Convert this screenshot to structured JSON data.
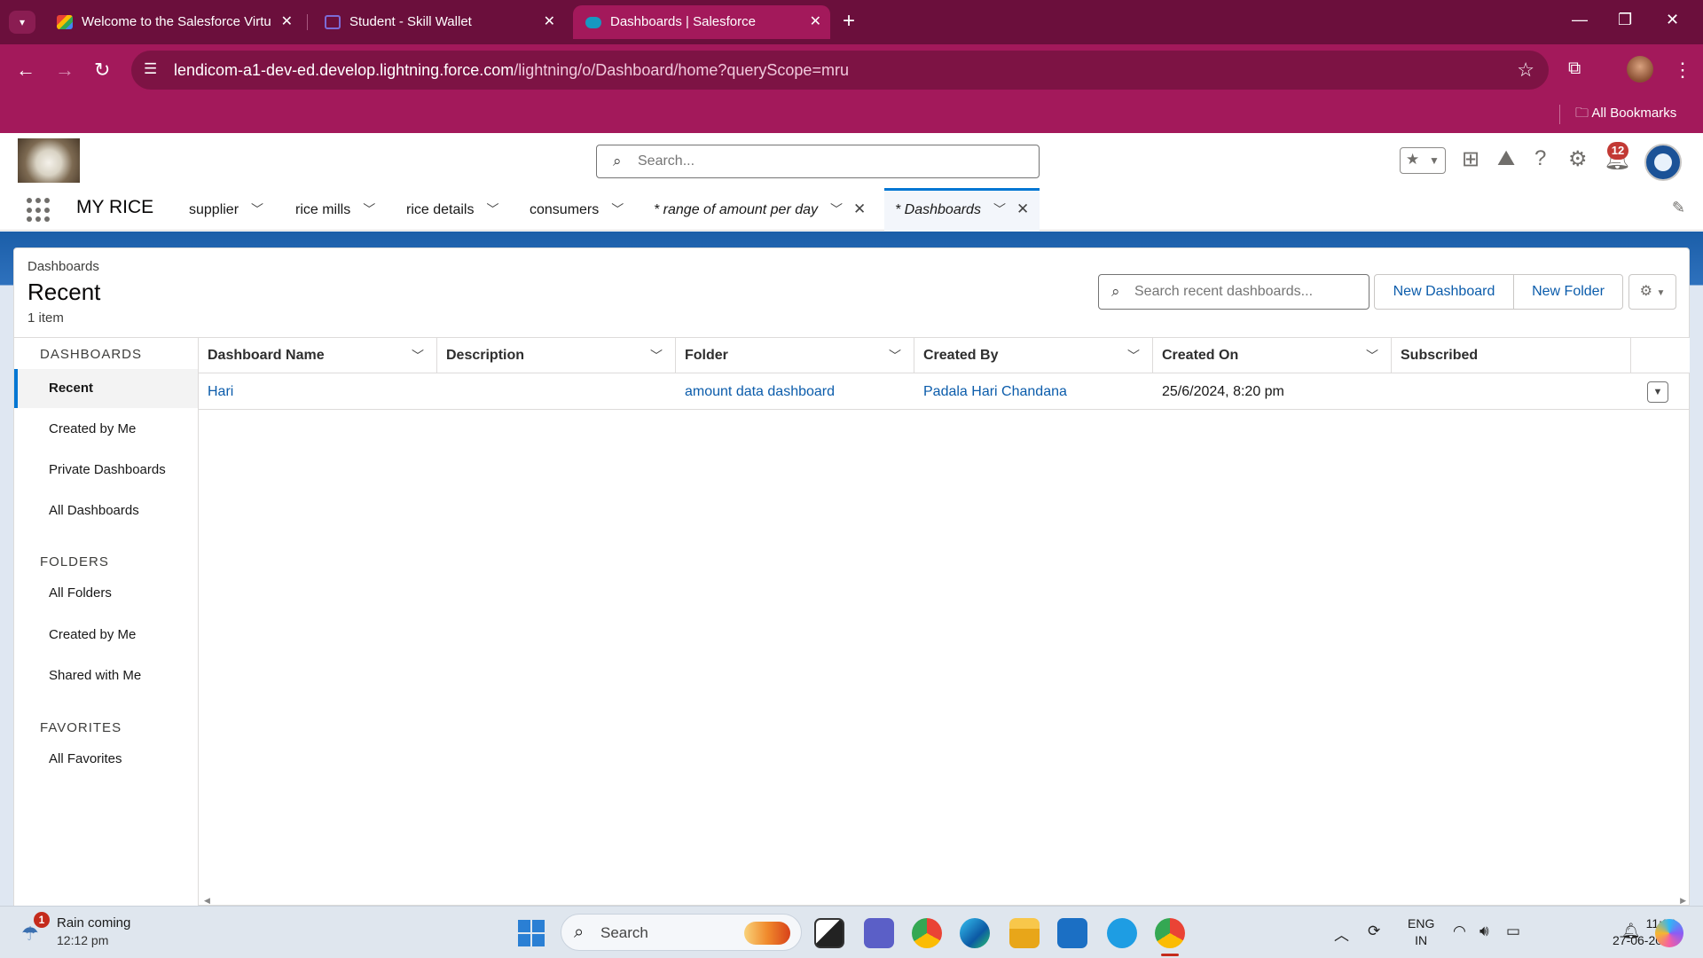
{
  "browser": {
    "tabs": [
      {
        "title": "Welcome to the Salesforce Virtu",
        "favicon": "gmail-icon"
      },
      {
        "title": "Student - Skill Wallet",
        "favicon": "skillwallet-icon"
      },
      {
        "title": "Dashboards | Salesforce",
        "favicon": "salesforce-cloud-icon"
      }
    ],
    "url_host": "lendicom-a1-dev-ed.develop.lightning.force.com",
    "url_path": "/lightning/o/Dashboard/home?queryScope=mru",
    "bookmarks_label": "All Bookmarks",
    "colors": {
      "tabbar": "#6b0f3c",
      "toolbar": "#a3195b"
    }
  },
  "sf": {
    "search_placeholder": "Search...",
    "notification_count": "12",
    "app_name": "MY RICE",
    "nav": [
      {
        "label": "supplier"
      },
      {
        "label": "rice mills"
      },
      {
        "label": "rice details"
      },
      {
        "label": "consumers"
      },
      {
        "label": "* range of amount per day"
      },
      {
        "label": "* Dashboards"
      }
    ]
  },
  "page": {
    "breadcrumb": "Dashboards",
    "title": "Recent",
    "item_count": "1 item",
    "search_placeholder": "Search recent dashboards...",
    "new_dashboard_label": "New Dashboard",
    "new_folder_label": "New Folder"
  },
  "sidebar": {
    "dashboards_heading": "DASHBOARDS",
    "dashboards_items": [
      "Recent",
      "Created by Me",
      "Private Dashboards",
      "All Dashboards"
    ],
    "folders_heading": "FOLDERS",
    "folders_items": [
      "All Folders",
      "Created by Me",
      "Shared with Me"
    ],
    "favorites_heading": "FAVORITES",
    "favorites_items": [
      "All Favorites"
    ]
  },
  "table": {
    "columns": [
      "Dashboard Name",
      "Description",
      "Folder",
      "Created By",
      "Created On",
      "Subscribed"
    ],
    "rows": [
      {
        "name": "Hari",
        "description": "",
        "folder": "amount data dashboard",
        "created_by": "Padala Hari Chandana",
        "created_on": "25/6/2024, 8:20 pm",
        "subscribed": ""
      }
    ]
  },
  "taskbar": {
    "weather_badge": "1",
    "weather_title": "Rain coming",
    "weather_time": "12:12 pm",
    "search_label": "Search",
    "lang_line1": "ENG",
    "lang_line2": "IN",
    "time": "11:32",
    "date": "27-06-2024"
  }
}
